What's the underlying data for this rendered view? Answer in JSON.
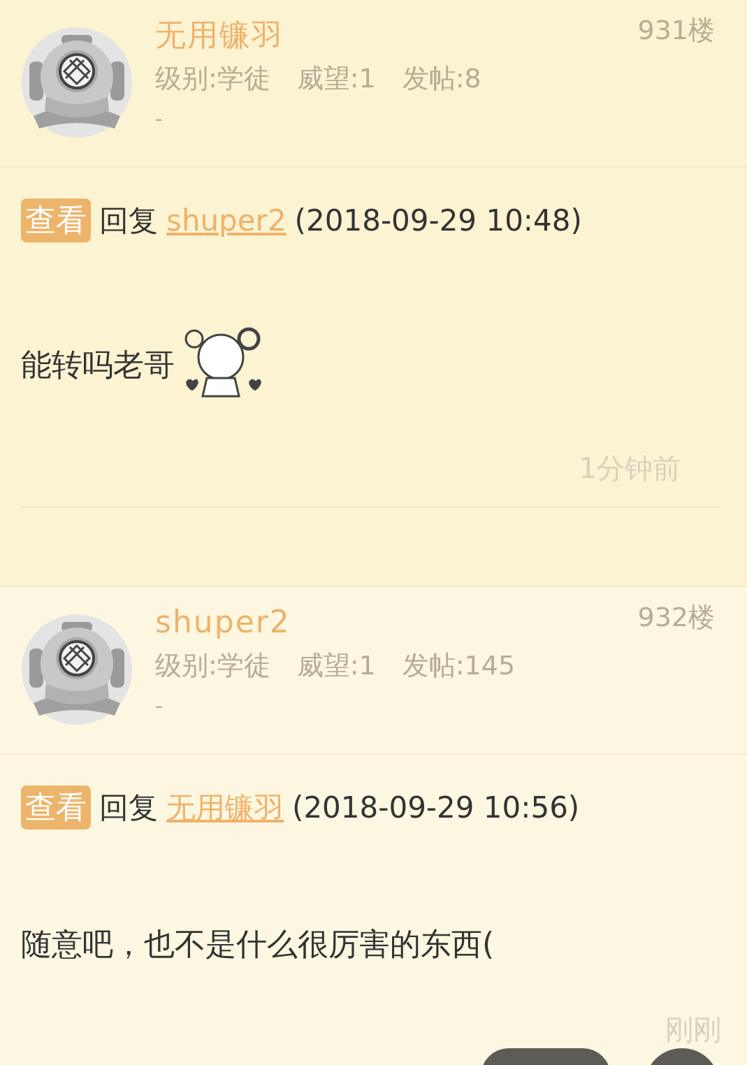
{
  "posts": [
    {
      "author": "无用镰羽",
      "floor": "931楼",
      "stats": [
        "级别:学徒",
        "威望:1",
        "发帖:8"
      ],
      "signature": "-",
      "tag": "查看",
      "reply_word": "回复",
      "reply_to": "shuper2",
      "reply_time": "(2018-09-29 10:48)",
      "text": "能转吗老哥",
      "sticker": true,
      "time": "1分钟前"
    },
    {
      "author": "shuper2",
      "floor": "932楼",
      "stats": [
        "级别:学徒",
        "威望:1",
        "发帖:145"
      ],
      "signature": "-",
      "tag": "查看",
      "reply_word": "回复",
      "reply_to": "无用镰羽",
      "reply_time": "(2018-09-29 10:56)",
      "text": "随意吧，也不是什么很厉害的东西(",
      "sticker": false,
      "time": "刚刚"
    }
  ]
}
